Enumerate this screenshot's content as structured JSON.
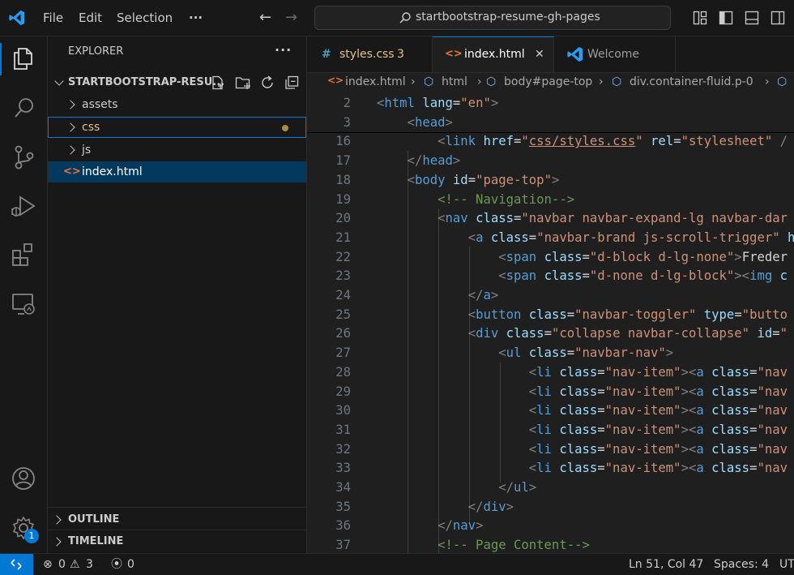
{
  "menu": [
    "File",
    "Edit",
    "Selection",
    "···"
  ],
  "command_center": {
    "label": "startbootstrap-resume-gh-pages"
  },
  "explorer": {
    "title": "EXPLORER",
    "folder": "STARTBOOTSTRAP-RESU...",
    "items": [
      "assets",
      "css",
      "js",
      "index.html"
    ],
    "outline": "OUTLINE",
    "timeline": "TIMELINE"
  },
  "tabs": [
    {
      "icon": "#",
      "label": "styles.css",
      "badge": "3"
    },
    {
      "icon": "<>",
      "label": "index.html",
      "close": "✕"
    },
    {
      "icon": "vscode",
      "label": "Welcome"
    }
  ],
  "breadcrumb": [
    "index.html",
    "html",
    "body#page-top",
    "div.container-fluid.p-0"
  ],
  "code_lines": [
    {
      "n": "2",
      "html": "<span class='br'>&lt;</span><span class='tag'>html</span> <span class='at'>lang</span><span class='tx'>=</span><span class='st'>\"en\"</span><span class='br'>&gt;</span>"
    },
    {
      "n": "3",
      "html": "    <span class='br'>&lt;</span><span class='tag'>head</span><span class='br'>&gt;</span>"
    },
    {
      "n": "16",
      "html": "        <span class='br'>&lt;</span><span class='tag'>link</span> <span class='at'>href</span><span class='tx'>=</span><span class='st'>\"<u>css/styles.css</u>\"</span> <span class='at'>rel</span><span class='tx'>=</span><span class='st'>\"stylesheet\"</span> <span class='br'>/</span>"
    },
    {
      "n": "17",
      "html": "    <span class='br'>&lt;/</span><span class='tag'>head</span><span class='br'>&gt;</span>"
    },
    {
      "n": "18",
      "html": "    <span class='br'>&lt;</span><span class='tag'>body</span> <span class='at'>id</span><span class='tx'>=</span><span class='st'>\"page-top\"</span><span class='br'>&gt;</span>"
    },
    {
      "n": "19",
      "html": "        <span class='cm'>&lt;!-- Navigation--&gt;</span>"
    },
    {
      "n": "20",
      "html": "        <span class='br'>&lt;</span><span class='tag'>nav</span> <span class='at'>class</span><span class='tx'>=</span><span class='st'>\"navbar navbar-expand-lg navbar-dar</span>"
    },
    {
      "n": "21",
      "html": "            <span class='br'>&lt;</span><span class='tag'>a</span> <span class='at'>class</span><span class='tx'>=</span><span class='st'>\"navbar-brand js-scroll-trigger\"</span> <span class='at'>h</span>"
    },
    {
      "n": "22",
      "html": "                <span class='br'>&lt;</span><span class='tag'>span</span> <span class='at'>class</span><span class='tx'>=</span><span class='st'>\"d-block d-lg-none\"</span><span class='br'>&gt;</span><span class='tx'>Freder</span>"
    },
    {
      "n": "23",
      "html": "                <span class='br'>&lt;</span><span class='tag'>span</span> <span class='at'>class</span><span class='tx'>=</span><span class='st'>\"d-none d-lg-block\"</span><span class='br'>&gt;&lt;</span><span class='tag'>img</span> <span class='at'>c</span>"
    },
    {
      "n": "24",
      "html": "            <span class='br'>&lt;/</span><span class='tag'>a</span><span class='br'>&gt;</span>"
    },
    {
      "n": "25",
      "html": "            <span class='br'>&lt;</span><span class='tag'>button</span> <span class='at'>class</span><span class='tx'>=</span><span class='st'>\"navbar-toggler\"</span> <span class='at'>type</span><span class='tx'>=</span><span class='st'>\"butto</span>"
    },
    {
      "n": "26",
      "html": "            <span class='br'>&lt;</span><span class='tag'>div</span> <span class='at'>class</span><span class='tx'>=</span><span class='st'>\"collapse navbar-collapse\"</span> <span class='at'>id</span><span class='tx'>=</span><span class='st'>\"</span>"
    },
    {
      "n": "27",
      "html": "                <span class='br'>&lt;</span><span class='tag'>ul</span> <span class='at'>class</span><span class='tx'>=</span><span class='st'>\"navbar-nav\"</span><span class='br'>&gt;</span>"
    },
    {
      "n": "28",
      "html": "                    <span class='br'>&lt;</span><span class='tag'>li</span> <span class='at'>class</span><span class='tx'>=</span><span class='st'>\"nav-item\"</span><span class='br'>&gt;&lt;</span><span class='tag'>a</span> <span class='at'>class</span><span class='tx'>=</span><span class='st'>\"nav</span>"
    },
    {
      "n": "29",
      "html": "                    <span class='br'>&lt;</span><span class='tag'>li</span> <span class='at'>class</span><span class='tx'>=</span><span class='st'>\"nav-item\"</span><span class='br'>&gt;&lt;</span><span class='tag'>a</span> <span class='at'>class</span><span class='tx'>=</span><span class='st'>\"nav</span>"
    },
    {
      "n": "30",
      "html": "                    <span class='br'>&lt;</span><span class='tag'>li</span> <span class='at'>class</span><span class='tx'>=</span><span class='st'>\"nav-item\"</span><span class='br'>&gt;&lt;</span><span class='tag'>a</span> <span class='at'>class</span><span class='tx'>=</span><span class='st'>\"nav</span>"
    },
    {
      "n": "31",
      "html": "                    <span class='br'>&lt;</span><span class='tag'>li</span> <span class='at'>class</span><span class='tx'>=</span><span class='st'>\"nav-item\"</span><span class='br'>&gt;&lt;</span><span class='tag'>a</span> <span class='at'>class</span><span class='tx'>=</span><span class='st'>\"nav</span>"
    },
    {
      "n": "32",
      "html": "                    <span class='br'>&lt;</span><span class='tag'>li</span> <span class='at'>class</span><span class='tx'>=</span><span class='st'>\"nav-item\"</span><span class='br'>&gt;&lt;</span><span class='tag'>a</span> <span class='at'>class</span><span class='tx'>=</span><span class='st'>\"nav</span>"
    },
    {
      "n": "33",
      "html": "                    <span class='br'>&lt;</span><span class='tag'>li</span> <span class='at'>class</span><span class='tx'>=</span><span class='st'>\"nav-item\"</span><span class='br'>&gt;&lt;</span><span class='tag'>a</span> <span class='at'>class</span><span class='tx'>=</span><span class='st'>\"nav</span>"
    },
    {
      "n": "34",
      "html": "                <span class='br'>&lt;/</span><span class='tag'>ul</span><span class='br'>&gt;</span>"
    },
    {
      "n": "35",
      "html": "            <span class='br'>&lt;/</span><span class='tag'>div</span><span class='br'>&gt;</span>"
    },
    {
      "n": "36",
      "html": "        <span class='br'>&lt;/</span><span class='tag'>nav</span><span class='br'>&gt;</span>"
    },
    {
      "n": "37",
      "html": "        <span class='cm'>&lt;!-- Page Content--&gt;</span>"
    }
  ],
  "status": {
    "errors": "0",
    "warnings": "3",
    "ports": "0",
    "position": "Ln 51, Col 47",
    "spaces": "Spaces: 4",
    "encoding": "UT"
  },
  "settings_badge": "1",
  "colors": {
    "accent": "#0078d4",
    "modified_dot": "#a88c3f",
    "folder_modified": "#e2c08d"
  }
}
